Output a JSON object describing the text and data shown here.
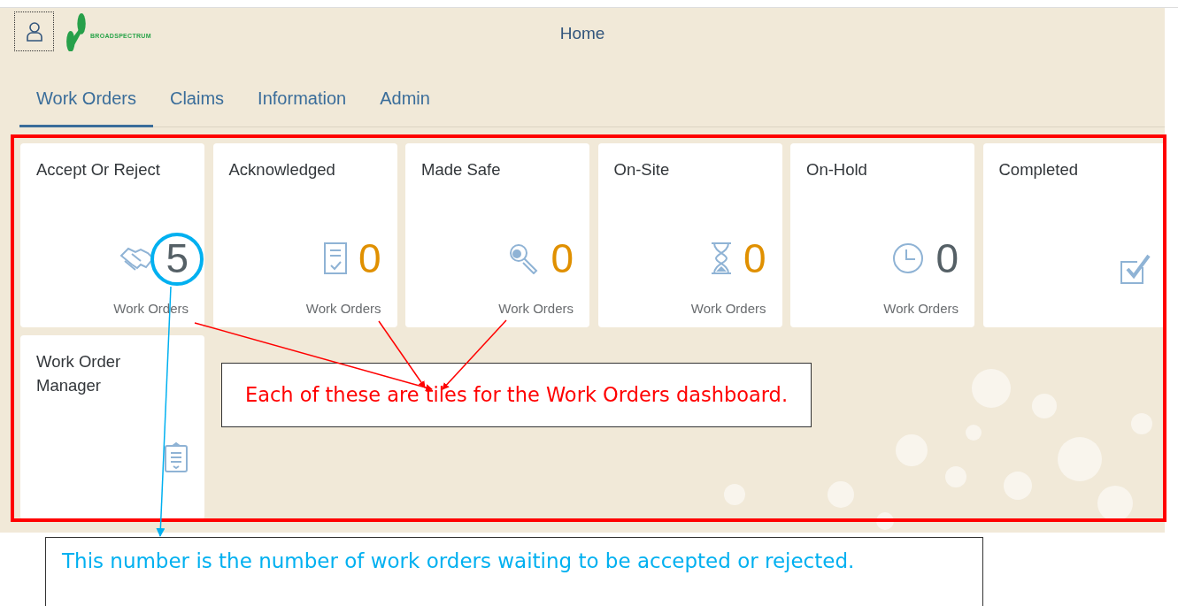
{
  "header": {
    "logo_text": "BROADSPECTRUM",
    "title": "Home"
  },
  "tabs": [
    {
      "label": "Work Orders",
      "selected": true
    },
    {
      "label": "Claims",
      "selected": false
    },
    {
      "label": "Information",
      "selected": false
    },
    {
      "label": "Admin",
      "selected": false
    }
  ],
  "tiles": [
    {
      "title": "Accept Or Reject",
      "number": "5",
      "color": "#556066",
      "footer": "Work Orders"
    },
    {
      "title": "Acknowledged",
      "number": "0",
      "color": "#e09000",
      "footer": "Work Orders"
    },
    {
      "title": "Made Safe",
      "number": "0",
      "color": "#e09000",
      "footer": "Work Orders"
    },
    {
      "title": "On-Site",
      "number": "0",
      "color": "#e09000",
      "footer": "Work Orders"
    },
    {
      "title": "On-Hold",
      "number": "0",
      "color": "#556066",
      "footer": "Work Orders"
    },
    {
      "title": "Completed"
    },
    {
      "title": "Work Order Manager"
    }
  ],
  "annotations": [
    {
      "kind": "tiles",
      "text": "Each of these are tiles for the Work Orders dashboard."
    },
    {
      "kind": "number",
      "text": "This number is the number of work orders waiting to be accepted or rejected."
    }
  ]
}
